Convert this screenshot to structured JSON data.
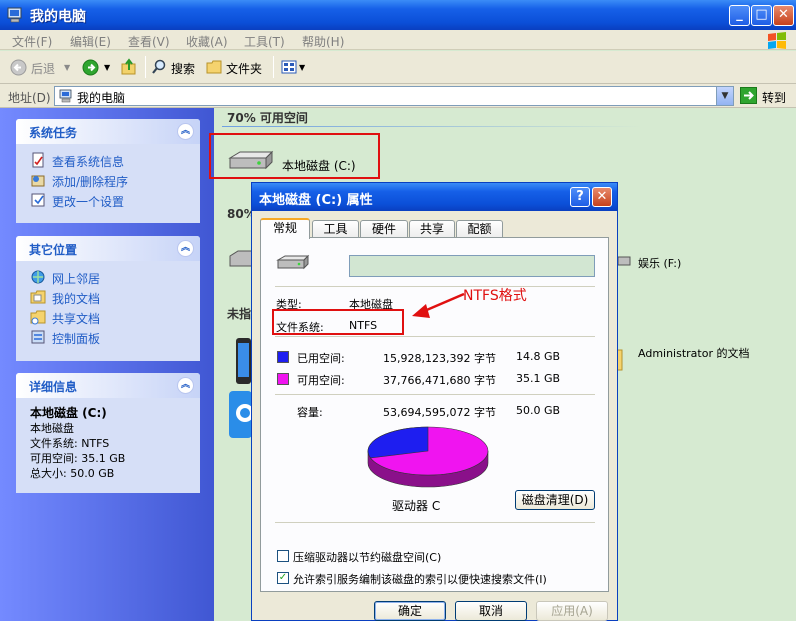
{
  "window": {
    "title": "我的电脑"
  },
  "menu": [
    "文件(F)",
    "编辑(E)",
    "查看(V)",
    "收藏(A)",
    "工具(T)",
    "帮助(H)"
  ],
  "toolbar": {
    "back": "后退",
    "search": "搜索",
    "folders": "文件夹"
  },
  "address": {
    "label": "地址(D)",
    "value": "我的电脑",
    "go": "转到"
  },
  "left_panel": {
    "tasks": {
      "title": "系统任务",
      "items": [
        "查看系统信息",
        "添加/删除程序",
        "更改一个设置"
      ]
    },
    "places": {
      "title": "其它位置",
      "items": [
        "网上邻居",
        "我的文档",
        "共享文档",
        "控制面板"
      ]
    },
    "details": {
      "title": "详细信息",
      "name": "本地磁盘 (C:)",
      "type": "本地磁盘",
      "fs": "文件系统: NTFS",
      "free": "可用空间: 35.1 GB",
      "total": "总大小: 50.0 GB"
    }
  },
  "content": {
    "group1": "70% 可用空间",
    "drive_c": "本地磁盘 (C:)",
    "group2_partial": "80%",
    "drive_f": "娱乐 (F:)",
    "group3_partial": "未指",
    "admin_docs": "Administrator 的文档"
  },
  "annotation": {
    "text": "NTFS格式",
    "color": "#e01010"
  },
  "dialog": {
    "title": "本地磁盘 (C:) 属性",
    "tabs": [
      "常规",
      "工具",
      "硬件",
      "共享",
      "配额"
    ],
    "label_value": "",
    "type_label": "类型:",
    "type_value": "本地磁盘",
    "fs_label": "文件系统:",
    "fs_value": "NTFS",
    "used_label": "已用空间:",
    "used_bytes": "15,928,123,392 字节",
    "used_gb": "14.8 GB",
    "free_label": "可用空间:",
    "free_bytes": "37,766,471,680 字节",
    "free_gb": "35.1 GB",
    "cap_label": "容量:",
    "cap_bytes": "53,694,595,072 字节",
    "cap_gb": "50.0 GB",
    "drive_label": "驱动器 C",
    "cleanup": "磁盘清理(D)",
    "compress": "压缩驱动器以节约磁盘空间(C)",
    "compress_checked": false,
    "index": "允许索引服务编制该磁盘的索引以便快速搜索文件(I)",
    "index_checked": true,
    "ok": "确定",
    "cancel": "取消",
    "apply": "应用(A)",
    "used_color": "#1e1ef0",
    "free_color": "#f014f0",
    "used_fraction": 0.297
  }
}
